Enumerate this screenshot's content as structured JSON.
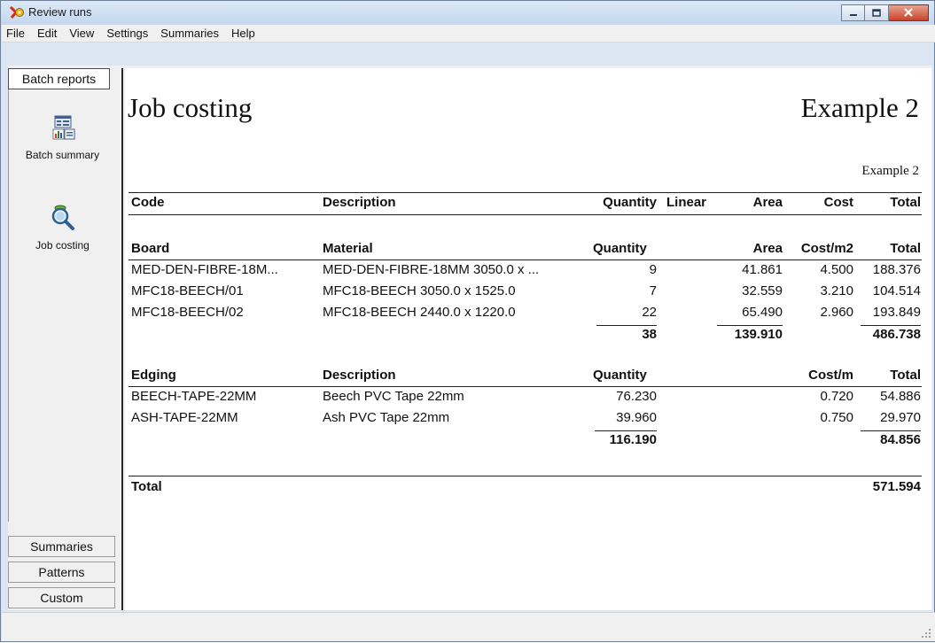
{
  "window": {
    "title": "Review runs",
    "icon": "gear-wrench-icon",
    "buttons": [
      "minimize-icon",
      "maximize-icon",
      "close-icon"
    ]
  },
  "menu": {
    "items": [
      "File",
      "Edit",
      "View",
      "Settings",
      "Summaries",
      "Help"
    ]
  },
  "sidebar": {
    "tabs_top": [
      "Batch reports"
    ],
    "items": [
      {
        "label": "Batch summary",
        "icon": "batch-summary-icon"
      },
      {
        "label": "Job costing",
        "icon": "job-costing-icon"
      }
    ],
    "tabs_bottom": [
      "Summaries",
      "Patterns",
      "Custom"
    ]
  },
  "report": {
    "title": "Job costing",
    "name": "Example 2",
    "subname": "Example 2",
    "header": {
      "code": "Code",
      "description": "Description",
      "quantity": "Quantity",
      "linear": "Linear",
      "area": "Area",
      "cost": "Cost",
      "total": "Total"
    },
    "boards": {
      "headers": {
        "code": "Board",
        "description": "Material",
        "quantity": "Quantity",
        "area": "Area",
        "cost": "Cost/m2",
        "total": "Total"
      },
      "rows": [
        {
          "code": "MED-DEN-FIBRE-18M...",
          "description": "MED-DEN-FIBRE-18MM 3050.0 x ...",
          "quantity": "9",
          "area": "41.861",
          "cost": "4.500",
          "total": "188.376"
        },
        {
          "code": "MFC18-BEECH/01",
          "description": "MFC18-BEECH 3050.0 x 1525.0",
          "quantity": "7",
          "area": "32.559",
          "cost": "3.210",
          "total": "104.514"
        },
        {
          "code": "MFC18-BEECH/02",
          "description": "MFC18-BEECH 2440.0 x 1220.0",
          "quantity": "22",
          "area": "65.490",
          "cost": "2.960",
          "total": "193.849"
        }
      ],
      "totals": {
        "quantity": "38",
        "area": "139.910",
        "total": "486.738"
      }
    },
    "edging": {
      "headers": {
        "code": "Edging",
        "description": "Description",
        "quantity": "Quantity",
        "cost": "Cost/m",
        "total": "Total"
      },
      "rows": [
        {
          "code": "BEECH-TAPE-22MM",
          "description": "Beech PVC Tape 22mm",
          "quantity": "76.230",
          "cost": "0.720",
          "total": "54.886"
        },
        {
          "code": "ASH-TAPE-22MM",
          "description": "Ash PVC Tape 22mm",
          "quantity": "39.960",
          "cost": "0.750",
          "total": "29.970"
        }
      ],
      "totals": {
        "quantity": "116.190",
        "total": "84.856"
      }
    },
    "grand_total": {
      "label": "Total",
      "value": "571.594"
    }
  }
}
